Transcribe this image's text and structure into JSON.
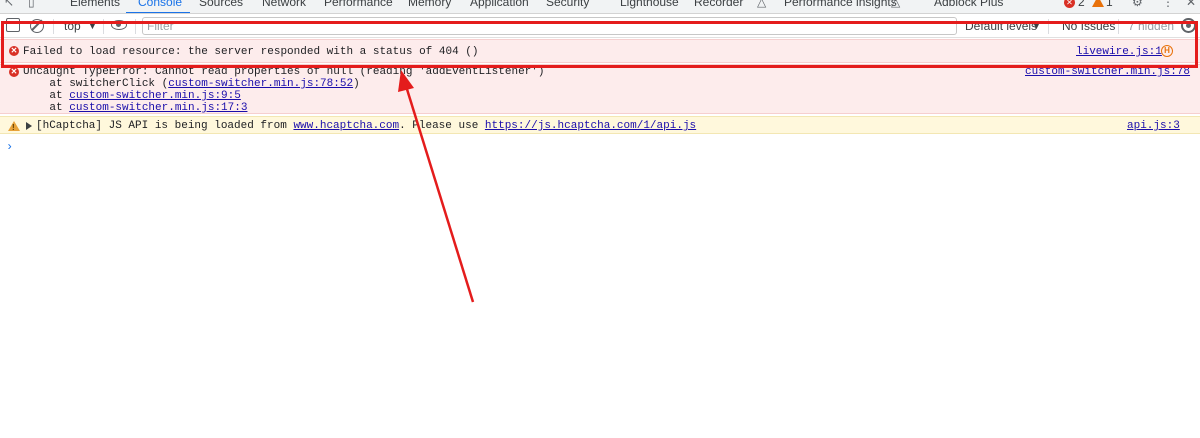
{
  "tabs": [
    "Elements",
    "Console",
    "Sources",
    "Network",
    "Performance",
    "Memory",
    "Application",
    "Security",
    "Lighthouse",
    "Recorder",
    "Performance insights",
    "Adblock Plus"
  ],
  "active_tab": "Console",
  "tab_counts": {
    "errors": "2",
    "warnings": "1"
  },
  "toolbar": {
    "context": "top",
    "filter_placeholder": "Filter",
    "levels": "Default levels",
    "issues": "No Issues",
    "hidden": "7 hidden"
  },
  "messages": [
    {
      "level": "error",
      "text": "Failed to load resource: the server responded with a status of 404 ()",
      "source": "livewire.js:1"
    },
    {
      "level": "error",
      "text": "Uncaught TypeError: Cannot read properties of null (reading 'addEventListener')",
      "source": "custom-switcher.min.js:78",
      "stack": [
        {
          "prefix": "    at switcherClick (",
          "link": "custom-switcher.min.js:78:52",
          "suffix": ")"
        },
        {
          "prefix": "    at ",
          "link": "custom-switcher.min.js:9:5",
          "suffix": ""
        },
        {
          "prefix": "    at ",
          "link": "custom-switcher.min.js:17:3",
          "suffix": ""
        }
      ]
    },
    {
      "level": "warning",
      "text_a": "[hCaptcha] JS API is being loaded from ",
      "link_a": "www.hcaptcha.com",
      "text_b": ". Please use ",
      "link_b": "https://js.hcaptcha.com/1/api.js",
      "source": "api.js:3"
    }
  ],
  "prompt": "›",
  "colors": {
    "accent": "#1a73e8",
    "error": "#d93025",
    "warning": "#e8a33a",
    "annotation": "#e41c1c"
  }
}
